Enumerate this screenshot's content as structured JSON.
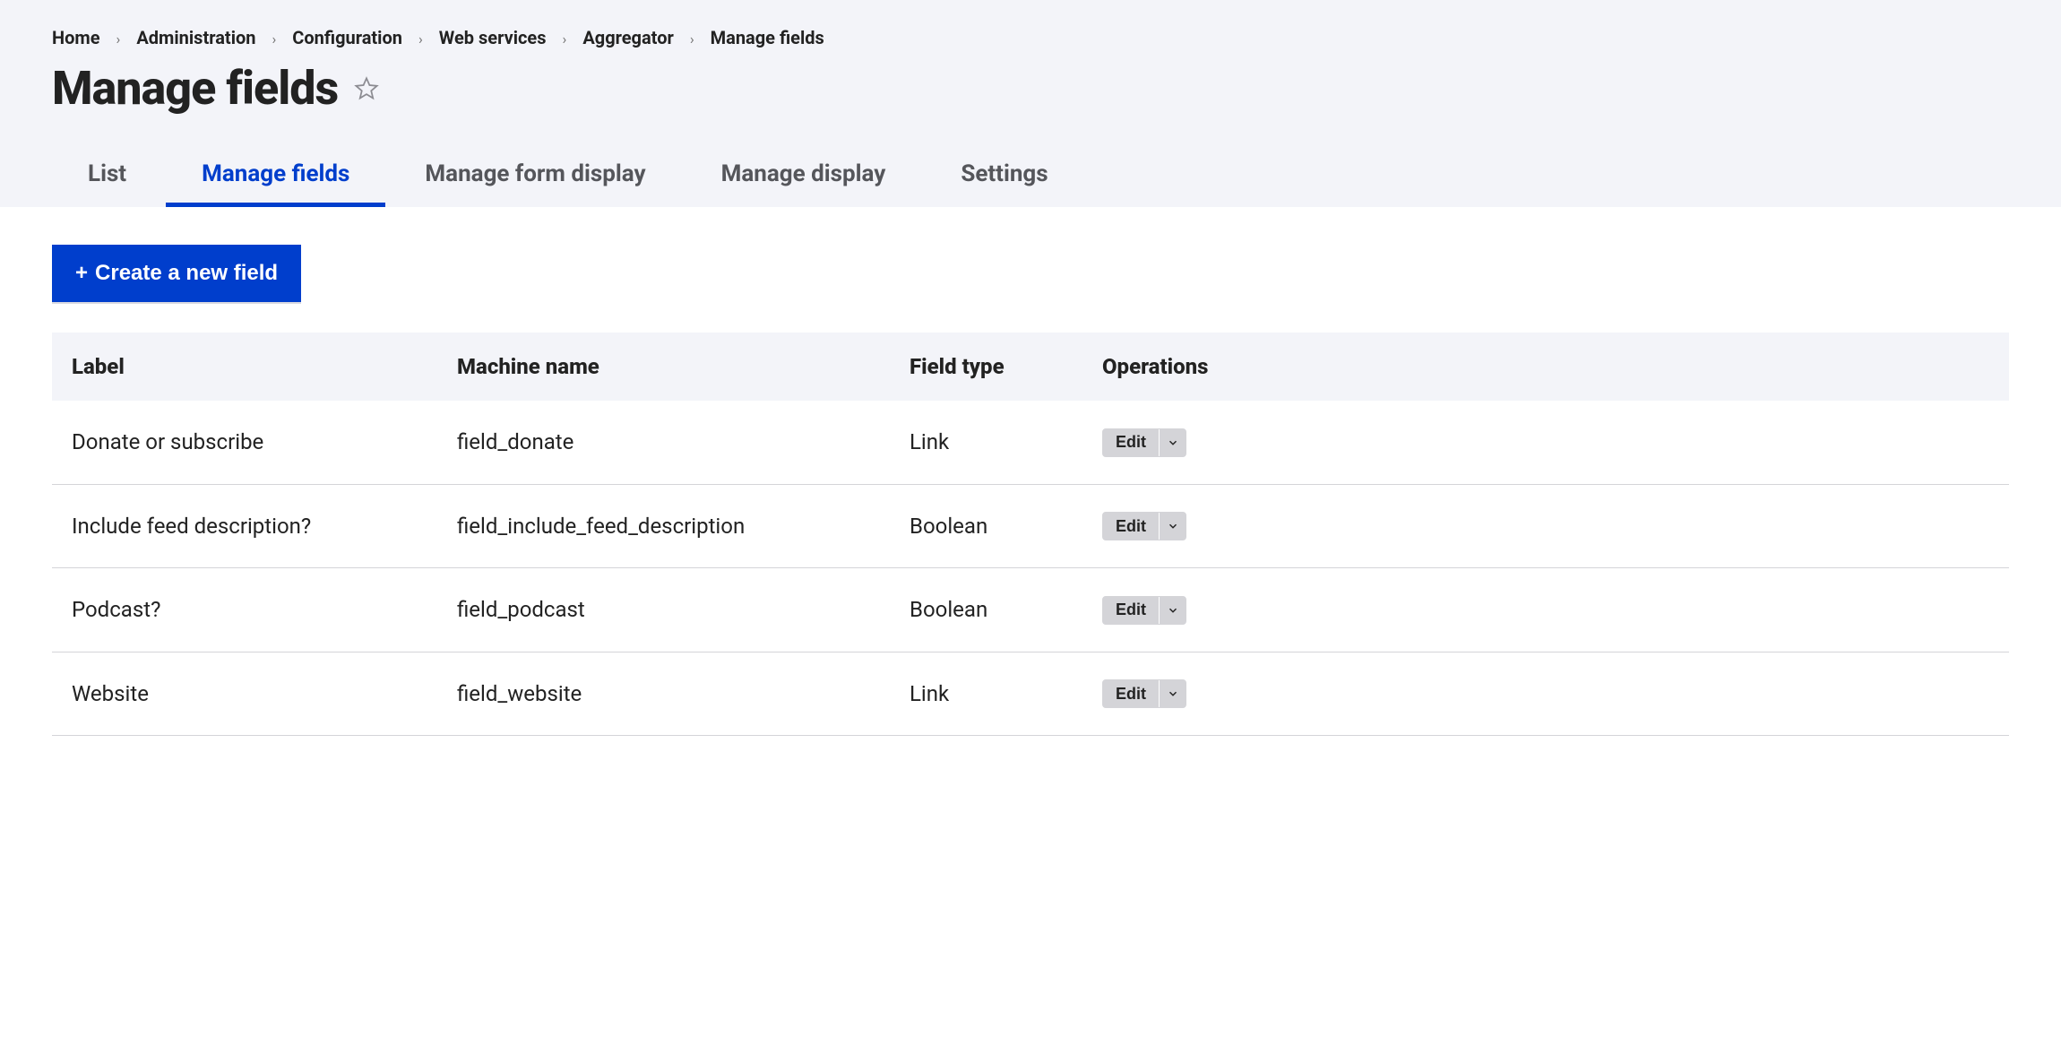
{
  "breadcrumb": {
    "items": [
      {
        "label": "Home"
      },
      {
        "label": "Administration"
      },
      {
        "label": "Configuration"
      },
      {
        "label": "Web services"
      },
      {
        "label": "Aggregator"
      },
      {
        "label": "Manage fields"
      }
    ]
  },
  "page_title": "Manage fields",
  "tabs": {
    "list": "List",
    "manage_fields": "Manage fields",
    "manage_form_display": "Manage form display",
    "manage_display": "Manage display",
    "settings": "Settings"
  },
  "active_tab": "manage_fields",
  "create_button": "Create a new field",
  "table": {
    "head": {
      "label": "Label",
      "machine_name": "Machine name",
      "field_type": "Field type",
      "operations": "Operations"
    },
    "rows": [
      {
        "label": "Donate or subscribe",
        "machine_name": "field_donate",
        "field_type": "Link",
        "op": "Edit"
      },
      {
        "label": "Include feed description?",
        "machine_name": "field_include_feed_description",
        "field_type": "Boolean",
        "op": "Edit"
      },
      {
        "label": "Podcast?",
        "machine_name": "field_podcast",
        "field_type": "Boolean",
        "op": "Edit"
      },
      {
        "label": "Website",
        "machine_name": "field_website",
        "field_type": "Link",
        "op": "Edit"
      }
    ]
  }
}
